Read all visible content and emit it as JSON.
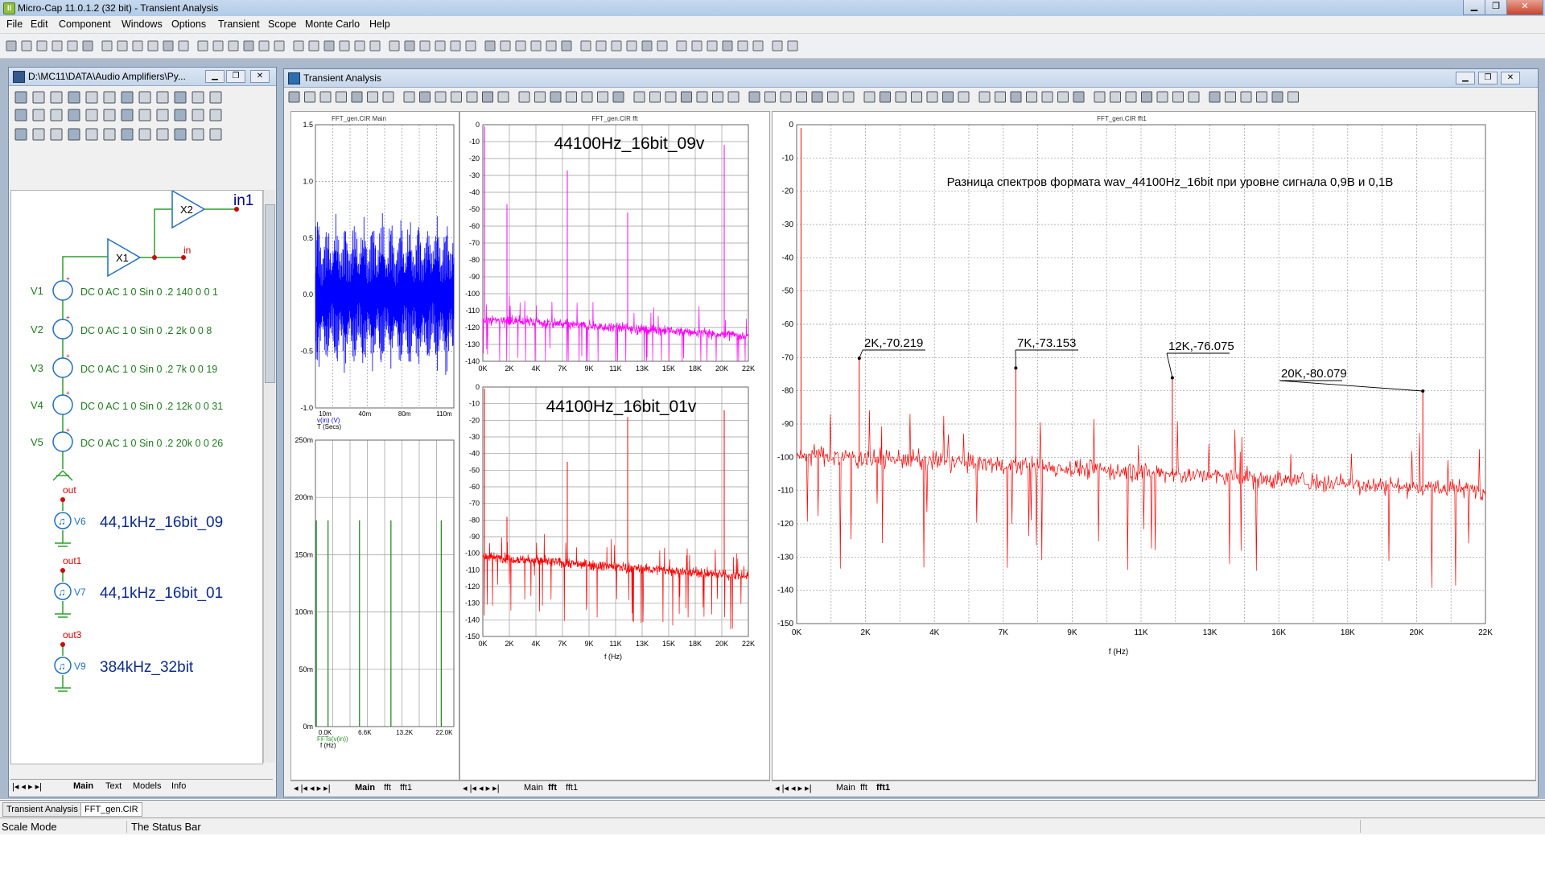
{
  "window": {
    "title": "Micro-Cap 11.0.1.2 (32 bit) - Transient Analysis",
    "app_badge": "II"
  },
  "menu": [
    "File",
    "Edit",
    "Component",
    "Windows",
    "Options",
    "Transient",
    "Scope",
    "Monte Carlo",
    "Help"
  ],
  "schematic_window": {
    "title": "D:\\MC11\\DATA\\Audio Amplifiers\\Py...",
    "components": {
      "x1": "X1",
      "x2": "X2",
      "in1": "in1",
      "in": "in",
      "sources": [
        {
          "name": "V1",
          "attr": "DC 0 AC 1 0 Sin 0 .2 140 0 0 1"
        },
        {
          "name": "V2",
          "attr": "DC 0 AC 1 0 Sin 0 .2 2k 0 0 8"
        },
        {
          "name": "V3",
          "attr": "DC 0 AC 1 0 Sin 0 .2 7k 0 0 19"
        },
        {
          "name": "V4",
          "attr": "DC 0 AC 1 0 Sin 0 .2 12k 0 0 31"
        },
        {
          "name": "V5",
          "attr": "DC 0 AC 1 0 Sin 0 .2 20k 0 0 26"
        }
      ],
      "wav_sources": [
        {
          "node": "out",
          "name": "V6",
          "label": "44,1kHz_16bit_09"
        },
        {
          "node": "out1",
          "name": "V7",
          "label": "44,1kHz_16bit_01"
        },
        {
          "node": "out3",
          "name": "V9",
          "label": "384kHz_32bit"
        }
      ]
    },
    "tabs": [
      "Main",
      "Text",
      "Models",
      "Info"
    ]
  },
  "analysis_window": {
    "title": "Transient Analysis",
    "plot_main": {
      "header": "FFT_gen.CIR Main",
      "top": {
        "yticks": [
          "1.5",
          "1.0",
          "0.5",
          "0.0",
          "-0.5",
          "-1.0"
        ],
        "xticks": [
          "10m",
          "40m",
          "80m",
          "110m"
        ],
        "ylabel": "v(in) (V)",
        "xlabel": "T (Secs)"
      },
      "bottom": {
        "yticks": [
          "250m",
          "200m",
          "150m",
          "100m",
          "50m",
          "0m"
        ],
        "xticks": [
          "0.0K",
          "6.6K",
          "13.2K",
          "22.0K"
        ],
        "ylabel": "FFTs(v(in))",
        "xlabel": "f (Hz)"
      },
      "tabs": [
        "Main",
        "fft",
        "fft1"
      ]
    },
    "plot_fft": {
      "header": "FFT_gen.CIR fft",
      "top_title": "44100Hz_16bit_09v",
      "bottom_title": "44100Hz_16bit_01v",
      "top_yticks": [
        "0",
        "-10",
        "-20",
        "-30",
        "-40",
        "-50",
        "-60",
        "-70",
        "-80",
        "-90",
        "-100",
        "-110",
        "-120",
        "-130",
        "-140"
      ],
      "bottom_yticks": [
        "0",
        "-10",
        "-20",
        "-30",
        "-40",
        "-50",
        "-60",
        "-70",
        "-80",
        "-90",
        "-100",
        "-110",
        "-120",
        "-130",
        "-140",
        "-150"
      ],
      "xticks": [
        "0K",
        "2K",
        "4K",
        "7K",
        "9K",
        "11K",
        "13K",
        "15K",
        "18K",
        "20K",
        "22K"
      ],
      "xlabel": "f (Hz)",
      "tabs": [
        "Main",
        "fft",
        "fft1"
      ]
    },
    "plot_fft1": {
      "header": "FFT_gen.CIR fft1",
      "annotation": "Разница спектров формата wav_44100Hz_16bit при уровне сигнала 0,9В и 0,1В",
      "yticks": [
        "0",
        "-10",
        "-20",
        "-30",
        "-40",
        "-50",
        "-60",
        "-70",
        "-80",
        "-90",
        "-100",
        "-110",
        "-120",
        "-130",
        "-140",
        "-150"
      ],
      "xticks": [
        "0K",
        "2K",
        "4K",
        "7K",
        "9K",
        "11K",
        "13K",
        "16K",
        "18K",
        "20K",
        "22K"
      ],
      "xlabel": "f (Hz)",
      "markers": [
        {
          "label": "2K,-70.219",
          "x": 2000,
          "y": -70.219
        },
        {
          "label": "7K,-73.153",
          "x": 7000,
          "y": -73.153
        },
        {
          "label": "12K,-76.075",
          "x": 12000,
          "y": -76.075
        },
        {
          "label": "20K,-80.079",
          "x": 20000,
          "y": -80.079
        }
      ],
      "tabs": [
        "Main",
        "fft",
        "fft1"
      ]
    }
  },
  "taskbar": [
    "Transient Analysis",
    "FFT_gen.CIR"
  ],
  "status": {
    "mode": "Scale Mode",
    "text": "The Status Bar"
  },
  "colors": {
    "trace_time": "#0000ff",
    "trace_fft_top": "#ff00ff",
    "trace_red": "#ff0000",
    "trace_green": "#2a8a2a",
    "workspace": "#abb9cc"
  }
}
